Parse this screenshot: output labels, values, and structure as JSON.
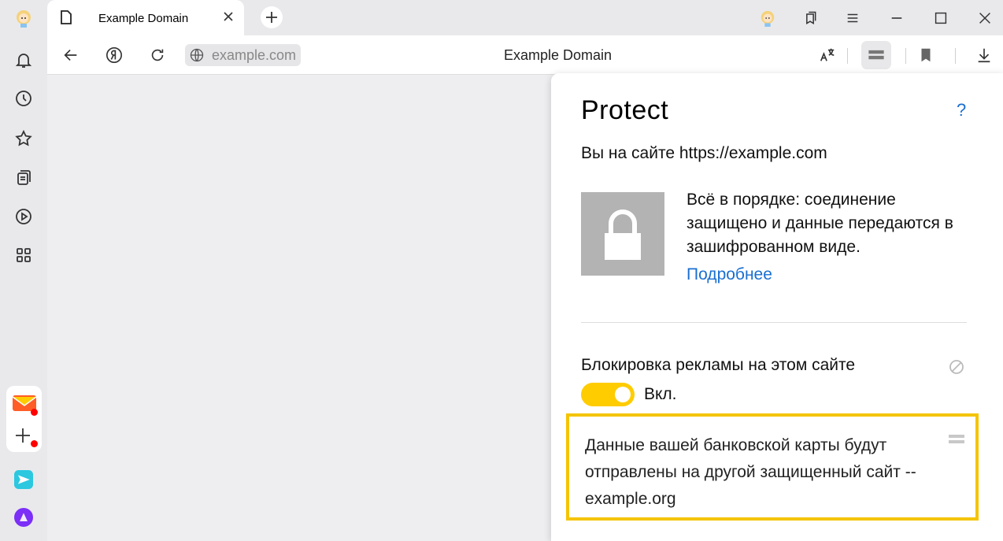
{
  "tab": {
    "title": "Example Domain"
  },
  "toolbar": {
    "url": "example.com",
    "page_title": "Example Domain"
  },
  "protect": {
    "title": "Protect",
    "help": "?",
    "site_line": "Вы на сайте https://example.com",
    "status": "Всё в порядке: соединение защищено и данные передаются в зашифрованном виде.",
    "more_link": "Подробнее",
    "ad_block_label": "Блокировка рекламы на этом сайте",
    "ad_block_state": "Вкл.",
    "warning": "Данные вашей банковской карты будут отправлены на другой защищенный сайт -- example.org"
  },
  "colors": {
    "accent_yellow": "#ffcc00",
    "link_blue": "#1a6fd1",
    "highlight_border": "#f5c400"
  },
  "icons": [
    "avatar-icon",
    "bell-icon",
    "clock-icon",
    "star-icon",
    "collections-icon",
    "play-icon",
    "apps-icon",
    "mail-icon",
    "plus-icon",
    "send-icon",
    "alice-icon",
    "file-icon",
    "close-icon",
    "new-tab-icon",
    "back-icon",
    "yandex-icon",
    "reload-icon",
    "globe-icon",
    "translate-icon",
    "protect-icon",
    "bookmark-icon",
    "download-icon",
    "lock-icon",
    "ad-block-icon"
  ]
}
